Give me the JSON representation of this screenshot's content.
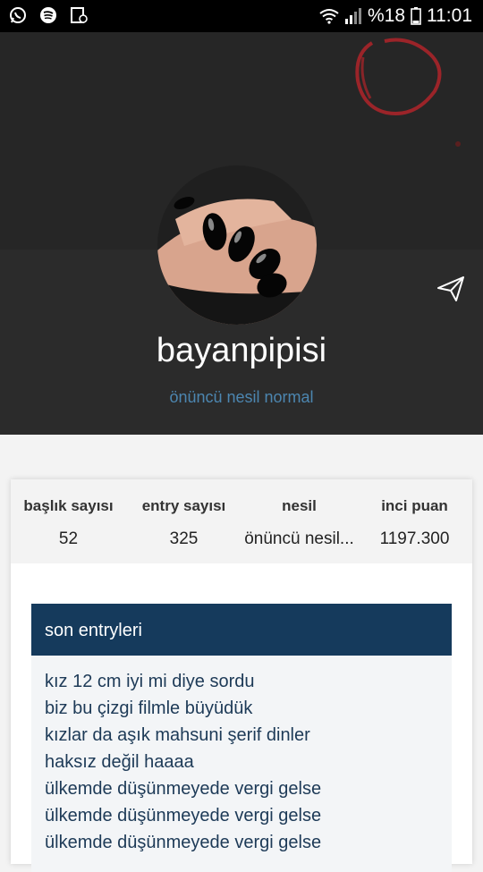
{
  "status_bar": {
    "battery": "%18",
    "time": "11:01",
    "left_icons": [
      "whatsapp-icon",
      "spotify-icon",
      "notification-icon"
    ],
    "right_icons": [
      "wifi-icon",
      "signal-icon",
      "battery-icon"
    ]
  },
  "profile": {
    "username": "bayanpipisi",
    "generation": "önüncü nesil normal"
  },
  "stats": [
    {
      "label": "başlık sayısı",
      "value": "52"
    },
    {
      "label": "entry sayısı",
      "value": "325"
    },
    {
      "label": "nesil",
      "value": "önüncü nesil..."
    },
    {
      "label": "inci puan",
      "value": "1197.300"
    }
  ],
  "entries": {
    "title": "son entryleri",
    "items": [
      "kız 12 cm iyi mi diye sordu",
      "biz bu çizgi filmle büyüdük",
      "kızlar da aşık mahsuni şerif dinler",
      "haksız değil haaaa",
      "ülkemde düşünmeyede vergi gelse",
      "ülkemde düşünmeyede vergi gelse",
      "ülkemde düşünmeyede vergi gelse"
    ]
  },
  "colors": {
    "header_bg": "#2b2b2b",
    "accent_blue": "#4c86b0",
    "entries_header_bg": "#153a5c",
    "entry_text": "#1d3a57"
  }
}
